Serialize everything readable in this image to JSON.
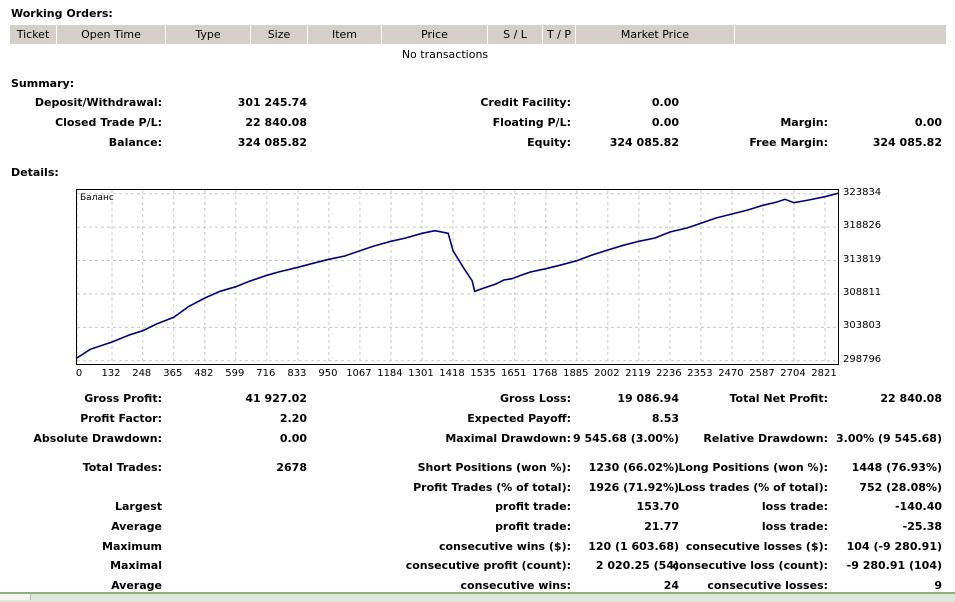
{
  "working_orders": {
    "title": "Working Orders:",
    "columns": [
      "Ticket",
      "Open Time",
      "Type",
      "Size",
      "Item",
      "Price",
      "S / L",
      "T / P",
      "Market Price"
    ],
    "empty_text": "No transactions"
  },
  "summary": {
    "title": "Summary:",
    "deposit_withdrawal_label": "Deposit/Withdrawal:",
    "deposit_withdrawal": "301 245.74",
    "credit_facility_label": "Credit Facility:",
    "credit_facility": "0.00",
    "closed_trade_pl_label": "Closed Trade P/L:",
    "closed_trade_pl": "22 840.08",
    "floating_pl_label": "Floating P/L:",
    "floating_pl": "0.00",
    "margin_label": "Margin:",
    "margin": "0.00",
    "balance_label": "Balance:",
    "balance": "324 085.82",
    "equity_label": "Equity:",
    "equity": "324 085.82",
    "free_margin_label": "Free Margin:",
    "free_margin": "324 085.82"
  },
  "details": {
    "title": "Details:"
  },
  "chart_data": {
    "type": "line",
    "title": "Баланс",
    "series": [
      {
        "x": [
          0,
          50,
          132,
          200,
          248,
          300,
          365,
          420,
          482,
          540,
          599,
          650,
          716,
          760,
          833,
          890,
          950,
          1010,
          1067,
          1120,
          1184,
          1240,
          1301,
          1350,
          1400,
          1418,
          1460,
          1490,
          1500,
          1535,
          1580,
          1610,
          1640,
          1680,
          1710,
          1768,
          1820,
          1885,
          1940,
          2002,
          2060,
          2119,
          2180,
          2236,
          2300,
          2353,
          2410,
          2470,
          2530,
          2587,
          2640,
          2670,
          2704,
          2760,
          2821,
          2870
        ],
        "y": [
          299200,
          300500,
          301600,
          302700,
          303300,
          304300,
          305300,
          306900,
          308200,
          309200,
          309900,
          310700,
          311600,
          312100,
          312800,
          313400,
          314000,
          314500,
          315300,
          316000,
          316700,
          317200,
          317900,
          318300,
          317900,
          315300,
          312600,
          310800,
          309200,
          309700,
          310300,
          310900,
          311100,
          311700,
          312100,
          312600,
          313100,
          313800,
          314600,
          315400,
          316100,
          316700,
          317200,
          318100,
          318700,
          319400,
          320200,
          320800,
          321400,
          322100,
          322600,
          323000,
          322500,
          322900,
          323400,
          323900
        ]
      }
    ],
    "xticks": [
      "0",
      "132",
      "248",
      "365",
      "482",
      "599",
      "716",
      "833",
      "950",
      "1067",
      "1184",
      "1301",
      "1418",
      "1535",
      "1651",
      "1768",
      "1885",
      "2002",
      "2119",
      "2236",
      "2353",
      "2470",
      "2587",
      "2704",
      "2821"
    ],
    "yticks": [
      "323834",
      "318826",
      "313819",
      "308811",
      "303803",
      "298796"
    ],
    "xlim": [
      0,
      2870
    ],
    "ylim": [
      298300,
      324400
    ],
    "grid": true,
    "line_color": "#00007f"
  },
  "stats": {
    "gross_profit_label": "Gross Profit:",
    "gross_profit": "41 927.02",
    "gross_loss_label": "Gross Loss:",
    "gross_loss": "19 086.94",
    "total_net_profit_label": "Total Net Profit:",
    "total_net_profit": "22 840.08",
    "profit_factor_label": "Profit Factor:",
    "profit_factor": "2.20",
    "expected_payoff_label": "Expected Payoff:",
    "expected_payoff": "8.53",
    "absolute_drawdown_label": "Absolute Drawdown:",
    "absolute_drawdown": "0.00",
    "maximal_drawdown_label": "Maximal Drawdown:",
    "maximal_drawdown": "9 545.68 (3.00%)",
    "relative_drawdown_label": "Relative Drawdown:",
    "relative_drawdown": "3.00% (9 545.68)",
    "total_trades_label": "Total Trades:",
    "total_trades": "2678",
    "short_positions_label": "Short Positions (won %):",
    "short_positions": "1230 (66.02%)",
    "long_positions_label": "Long Positions (won %):",
    "long_positions": "1448 (76.93%)",
    "profit_trades_label": "Profit Trades (% of total):",
    "profit_trades": "1926 (71.92%)",
    "loss_trades_label": "Loss trades (% of total):",
    "loss_trades": "752 (28.08%)",
    "largest_label": "Largest",
    "largest_profit_label": "profit trade:",
    "largest_profit": "153.70",
    "largest_loss_label": "loss trade:",
    "largest_loss": "-140.40",
    "average_label": "Average",
    "average_profit_label": "profit trade:",
    "average_profit": "21.77",
    "average_loss_label": "loss trade:",
    "average_loss": "-25.38",
    "maximum_label": "Maximum",
    "max_consec_wins_label": "consecutive wins ($):",
    "max_consec_wins": "120 (1 603.68)",
    "max_consec_losses_label": "consecutive losses ($):",
    "max_consec_losses": "104 (-9 280.91)",
    "maximal_label": "Maximal",
    "maximal_consec_profit_label": "consecutive profit (count):",
    "maximal_consec_profit": "2 020.25 (54)",
    "maximal_consec_loss_label": "consecutive loss (count):",
    "maximal_consec_loss": "-9 280.91 (104)",
    "average2_label": "Average",
    "avg_consec_wins_label": "consecutive wins:",
    "avg_consec_wins": "24",
    "avg_consec_losses_label": "consecutive losses:",
    "avg_consec_losses": "9"
  }
}
